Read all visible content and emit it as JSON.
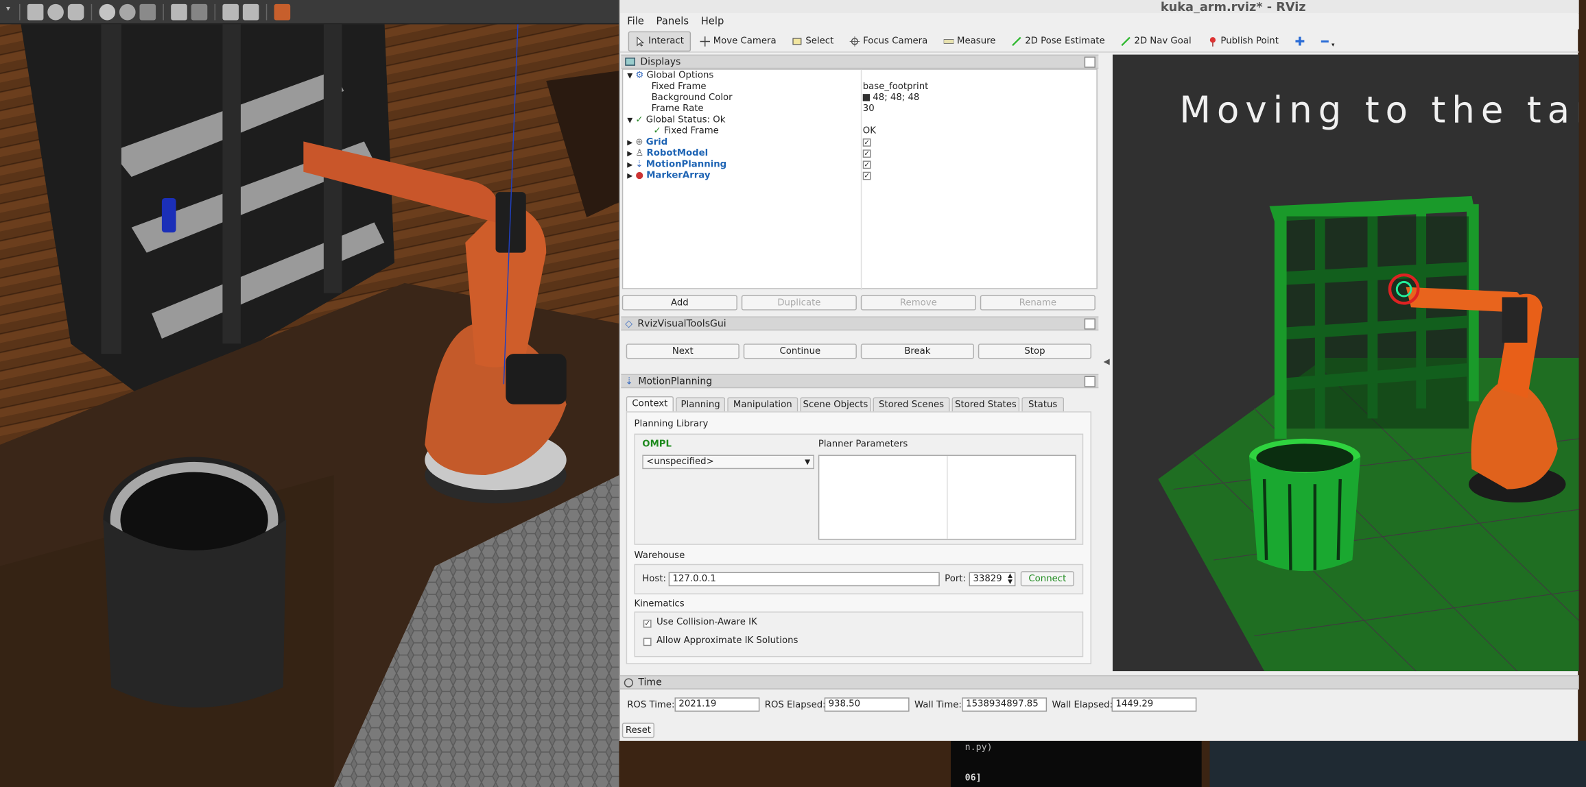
{
  "window": {
    "title": "kuka_arm.rviz* - RViz"
  },
  "menu": [
    "File",
    "Panels",
    "Help"
  ],
  "toolbar": [
    {
      "label": "Interact",
      "icon": "cursor-icon",
      "active": true
    },
    {
      "label": "Move Camera",
      "icon": "move-camera-icon"
    },
    {
      "label": "Select",
      "icon": "select-icon"
    },
    {
      "label": "Focus Camera",
      "icon": "focus-camera-icon"
    },
    {
      "label": "Measure",
      "icon": "ruler-icon"
    },
    {
      "label": "2D Pose Estimate",
      "icon": "arrow-green-icon"
    },
    {
      "label": "2D Nav Goal",
      "icon": "arrow-green-icon"
    },
    {
      "label": "Publish Point",
      "icon": "map-pin-icon"
    }
  ],
  "displays": {
    "header": "Displays",
    "rows": [
      {
        "label": "Global Options",
        "value": ""
      },
      {
        "label": "Fixed Frame",
        "value": "base_footprint"
      },
      {
        "label": "Background Color",
        "value": "48; 48; 48"
      },
      {
        "label": "Frame Rate",
        "value": "30"
      },
      {
        "label": "Global Status: Ok",
        "value": ""
      },
      {
        "label": "Fixed Frame",
        "value": "OK"
      },
      {
        "label": "Grid",
        "value": ""
      },
      {
        "label": "RobotModel",
        "value": ""
      },
      {
        "label": "MotionPlanning",
        "value": ""
      },
      {
        "label": "MarkerArray",
        "value": ""
      }
    ],
    "buttons": {
      "add": "Add",
      "duplicate": "Duplicate",
      "remove": "Remove",
      "rename": "Rename"
    }
  },
  "visual_tools": {
    "header": "RvizVisualToolsGui",
    "buttons": {
      "next": "Next",
      "continue": "Continue",
      "break": "Break",
      "stop": "Stop"
    }
  },
  "motion_planning": {
    "header": "MotionPlanning",
    "tabs": [
      "Context",
      "Planning",
      "Manipulation",
      "Scene Objects",
      "Stored Scenes",
      "Stored States",
      "Status"
    ],
    "planning_library": "Planning Library",
    "ompl": "OMPL",
    "planner": "<unspecified>",
    "planner_params": "Planner Parameters",
    "warehouse": "Warehouse",
    "host_label": "Host:",
    "host": "127.0.0.1",
    "port_label": "Port:",
    "port": "33829",
    "connect": "Connect",
    "kinematics": "Kinematics",
    "collision_ik": "Use Collision-Aware IK",
    "approx_ik": "Allow Approximate IK Solutions"
  },
  "viewport": {
    "message": "Moving to the target"
  },
  "time": {
    "header": "Time",
    "ros_time_label": "ROS Time:",
    "ros_time": "2021.19",
    "ros_elapsed_label": "ROS Elapsed:",
    "ros_elapsed": "938.50",
    "wall_time_label": "Wall Time:",
    "wall_time": "1538934897.85",
    "wall_elapsed_label": "Wall Elapsed:",
    "wall_elapsed": "1449.29",
    "reset": "Reset"
  },
  "terminal": {
    "line1": "n.py)",
    "line2": "06]"
  }
}
